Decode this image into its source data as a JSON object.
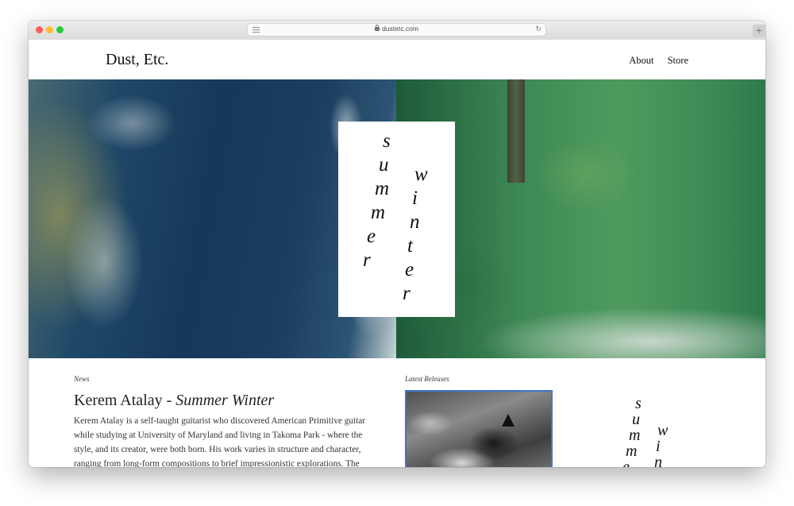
{
  "browser": {
    "url": "dustetc.com",
    "icons": {
      "reader": "reader-view-icon",
      "lock": "lock-icon",
      "reload": "reload-icon",
      "new_tab": "plus-icon"
    },
    "new_tab_symbol": "+",
    "reload_symbol": "↻"
  },
  "site": {
    "logo": "Dust, Etc.",
    "nav": [
      "About",
      "Store"
    ]
  },
  "hero": {
    "artwork_word_1": "summer",
    "artwork_word_2": "winter"
  },
  "news": {
    "label": "News",
    "title_prefix": "Kerem Atalay - ",
    "title_italic": "Summer Winter",
    "body": "Kerem Atalay is a self-taught guitarist who discovered American Primitive guitar while studying at University of Maryland and living in Takoma Park - where the style, and its creator, were both born. His work varies in structure and character, ranging from long-form compositions to brief impressionistic explorations. The"
  },
  "releases": {
    "label": "Latest Releases"
  },
  "colors": {
    "accent_border": "#3d78c9",
    "traffic_red": "#fe5f57",
    "traffic_yellow": "#febc2e",
    "traffic_green": "#28c840"
  }
}
